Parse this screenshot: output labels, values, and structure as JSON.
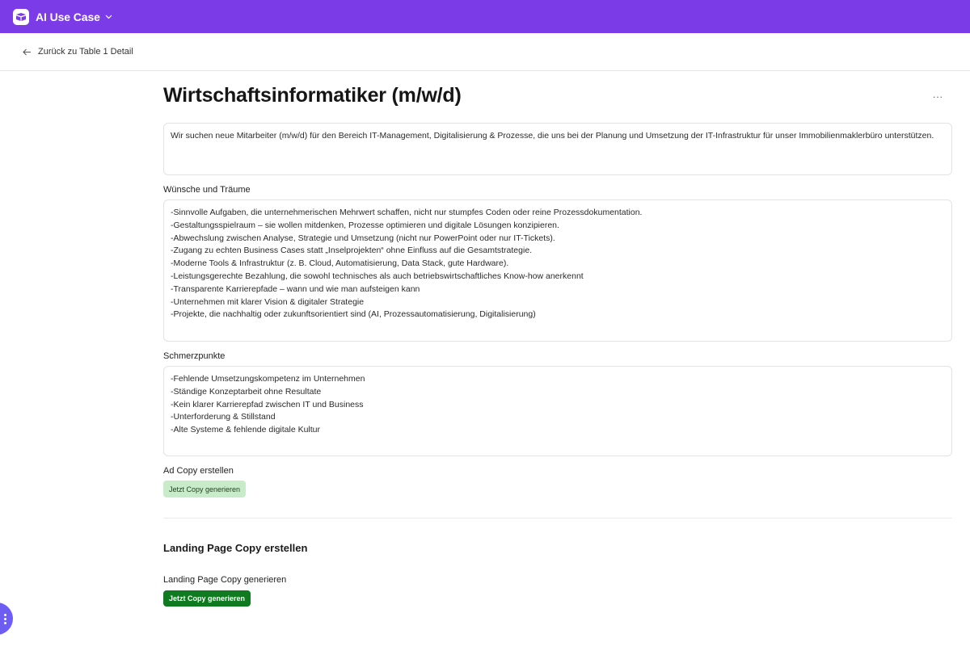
{
  "app": {
    "title": "AI Use Case",
    "logo_icon": "box-icon",
    "chevron_icon": "chevron-down-icon"
  },
  "nav": {
    "back_label": "Zurück zu Table 1 Detail",
    "back_icon": "arrow-left-icon"
  },
  "record": {
    "title": "Wirtschaftsinformatiker (m/w/d)",
    "more_label": "...",
    "description": "Wir suchen neue Mitarbeiter (m/w/d) für den Bereich IT-Management, Digitalisierung & Prozesse, die uns bei der Planung und Umsetzung der IT-Infrastruktur für unser Immobilienmaklerbüro unterstützen."
  },
  "wishes": {
    "label": "Wünsche und Träume",
    "lines": [
      "-Sinnvolle Aufgaben, die unternehmerischen Mehrwert schaffen, nicht nur stumpfes Coden oder reine Prozessdokumentation.",
      "-Gestaltungsspielraum – sie wollen mitdenken, Prozesse optimieren und digitale Lösungen konzipieren.",
      "-Abwechslung zwischen Analyse, Strategie und Umsetzung (nicht nur PowerPoint oder nur IT-Tickets).",
      "-Zugang zu echten Business Cases statt „Inselprojekten“ ohne Einfluss auf die Gesamtstrategie.",
      "-Moderne Tools & Infrastruktur (z. B. Cloud, Automatisierung, Data Stack, gute Hardware).",
      "-Leistungsgerechte Bezahlung, die sowohl technisches als auch betriebswirtschaftliches Know-how anerkennt",
      "-Transparente Karrierepfade – wann und wie man aufsteigen kann",
      "-Unternehmen mit klarer Vision & digitaler Strategie",
      "-Projekte, die nachhaltig oder zukunftsorientiert sind (AI, Prozessautomatisierung, Digitalisierung)"
    ]
  },
  "pains": {
    "label": "Schmerzpunkte",
    "lines": [
      "-Fehlende Umsetzungskompetenz im Unternehmen",
      "-Ständige Konzeptarbeit ohne Resultate",
      "-Kein klarer Karrierepfad zwischen IT und Business",
      "-Unterforderung & Stillstand",
      "-Alte Systeme & fehlende digitale Kultur"
    ]
  },
  "ad_copy": {
    "label": "Ad Copy erstellen",
    "button": "Jetzt Copy generieren"
  },
  "landing_page": {
    "heading": "Landing Page Copy erstellen",
    "label": "Landing Page Copy generieren",
    "button": "Jetzt Copy generieren"
  },
  "fab": {
    "icon": "dots-vertical-icon"
  },
  "colors": {
    "brand": "#7b3be6",
    "button_light": "#c8ecc9",
    "button_dark": "#0f7a1f",
    "fab": "#6d5df0"
  }
}
